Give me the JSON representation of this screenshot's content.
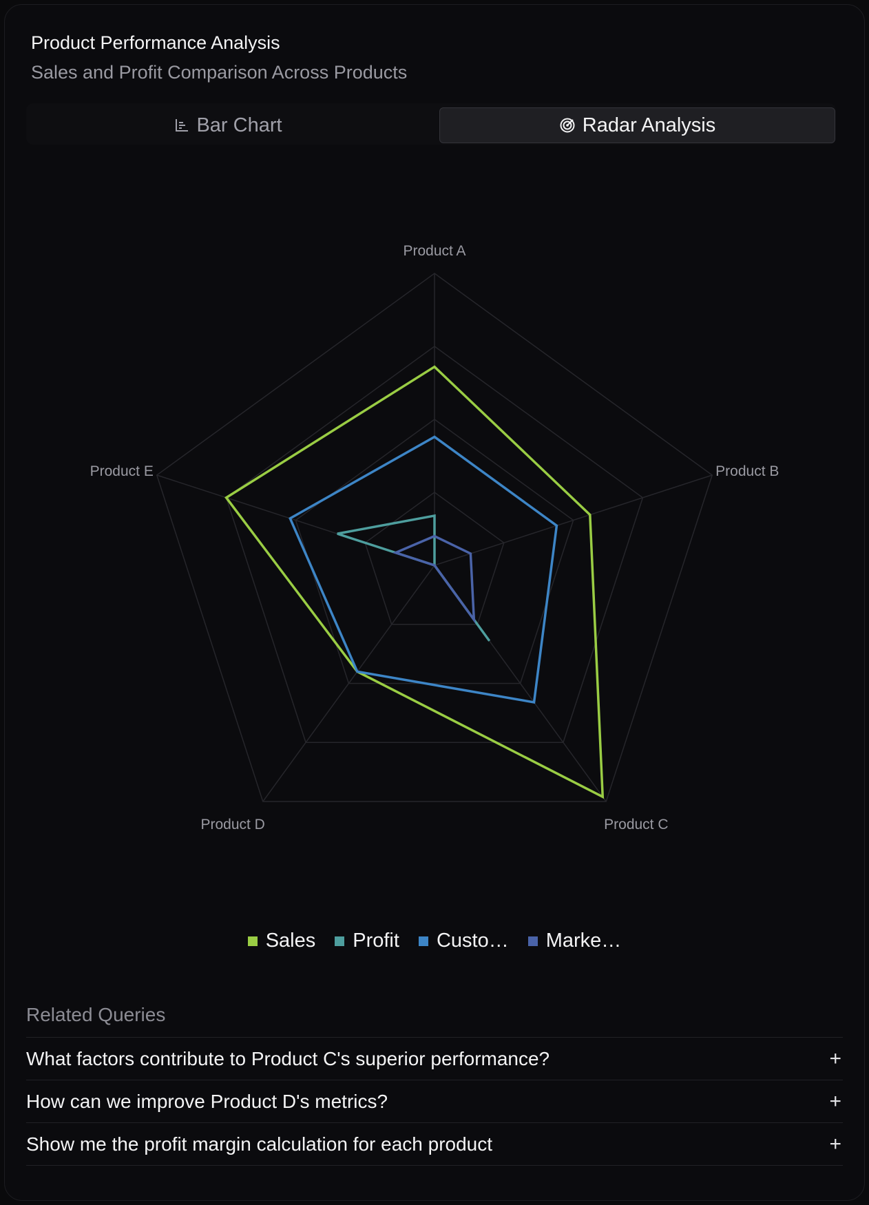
{
  "header": {
    "title": "Product Performance Analysis",
    "subtitle": "Sales and Profit Comparison Across Products"
  },
  "tabs": [
    {
      "label": "Bar Chart",
      "icon": "bar-chart-icon",
      "active": false
    },
    {
      "label": "Radar Analysis",
      "icon": "radar-icon",
      "active": true
    }
  ],
  "chart_data": {
    "type": "radar",
    "categories": [
      "Product A",
      "Product B",
      "Product C",
      "Product D",
      "Product E"
    ],
    "max": 1000,
    "rings": 4,
    "series": [
      {
        "name": "Sales",
        "legend_label": "Sales",
        "color": "#9acd44",
        "values": [
          680,
          560,
          980,
          450,
          750
        ]
      },
      {
        "name": "Profit",
        "legend_label": "Profit",
        "color": "#4e9e9e",
        "values": [
          170,
          0,
          320,
          0,
          350
        ]
      },
      {
        "name": "Customer",
        "legend_label": "Custo…",
        "color": "#3d85c6",
        "values": [
          440,
          440,
          580,
          450,
          520
        ]
      },
      {
        "name": "Market",
        "legend_label": "Marke…",
        "color": "#4a63a8",
        "values": [
          100,
          130,
          230,
          0,
          140
        ]
      }
    ]
  },
  "related": {
    "heading": "Related Queries",
    "items": [
      "What factors contribute to Product C's superior performance?",
      "How can we improve Product D's metrics?",
      "Show me the profit margin calculation for each product"
    ]
  },
  "colors": {
    "background": "#0b0b0e",
    "grid": "#26262b",
    "axis_label": "#9a9aa2"
  }
}
